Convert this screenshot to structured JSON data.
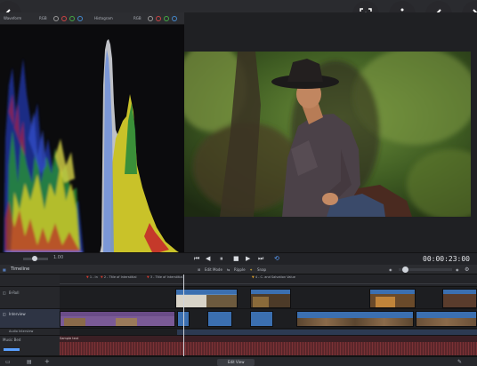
{
  "scopes": {
    "tab1_label": "Waveform",
    "tab2_label": "Histogram",
    "mode_label": "RGB"
  },
  "transport": {
    "timecode": "00:00:23:00",
    "zoom_label": "1.00"
  },
  "timeline": {
    "title": "Timeline",
    "edit_label": "Edit Mode",
    "ripple_label": "Ripple",
    "snap_label": "Snap",
    "markers": [
      "1 - In",
      "2 - Title of Interstitial",
      "3 - Title of Interstitial",
      "4 - C. and Salvation Value"
    ],
    "tracks": [
      {
        "name": "B-Roll"
      },
      {
        "name": "Interview"
      },
      {
        "name": "Audio Interview"
      },
      {
        "name": "Music Bed"
      }
    ],
    "audio_label": "Sample text"
  },
  "bottom": {
    "center_label": "Edit View"
  },
  "colors": {
    "accent": "#2f6fd6",
    "marker": "#d23b2f",
    "clip_video": "#3b6fb0",
    "clip_title": "#7a5a96",
    "audio": "#7c3236"
  }
}
